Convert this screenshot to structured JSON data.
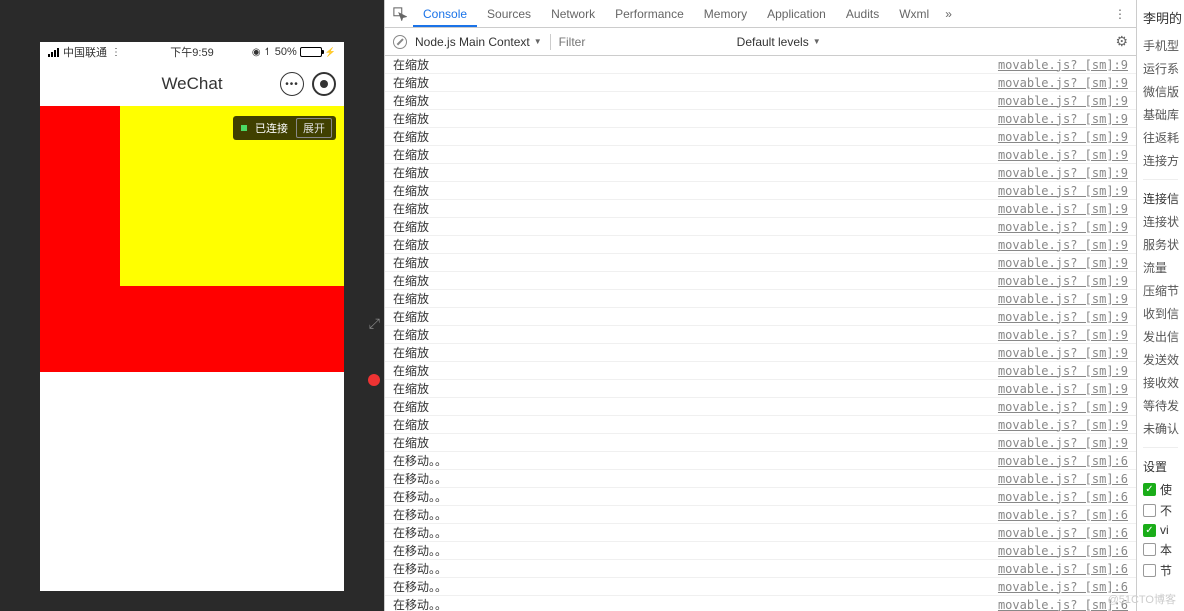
{
  "simulator": {
    "carrier": "中国联通",
    "time": "下午9:59",
    "battery_pct": "50%",
    "title": "WeChat",
    "conn_status": "已连接",
    "conn_btn": "展开"
  },
  "devtools": {
    "tabs": [
      "Console",
      "Sources",
      "Network",
      "Performance",
      "Memory",
      "Application",
      "Audits",
      "Wxml"
    ],
    "active_tab": "Console",
    "more": "»",
    "context": "Node.js Main Context",
    "filter_placeholder": "Filter",
    "levels": "Default levels",
    "logs_scale": [
      {
        "msg": "在缩放",
        "src": "movable.js? [sm]:9"
      },
      {
        "msg": "在缩放",
        "src": "movable.js? [sm]:9"
      },
      {
        "msg": "在缩放",
        "src": "movable.js? [sm]:9"
      },
      {
        "msg": "在缩放",
        "src": "movable.js? [sm]:9"
      },
      {
        "msg": "在缩放",
        "src": "movable.js? [sm]:9"
      },
      {
        "msg": "在缩放",
        "src": "movable.js? [sm]:9"
      },
      {
        "msg": "在缩放",
        "src": "movable.js? [sm]:9"
      },
      {
        "msg": "在缩放",
        "src": "movable.js? [sm]:9"
      },
      {
        "msg": "在缩放",
        "src": "movable.js? [sm]:9"
      },
      {
        "msg": "在缩放",
        "src": "movable.js? [sm]:9"
      },
      {
        "msg": "在缩放",
        "src": "movable.js? [sm]:9"
      },
      {
        "msg": "在缩放",
        "src": "movable.js? [sm]:9"
      },
      {
        "msg": "在缩放",
        "src": "movable.js? [sm]:9"
      },
      {
        "msg": "在缩放",
        "src": "movable.js? [sm]:9"
      },
      {
        "msg": "在缩放",
        "src": "movable.js? [sm]:9"
      },
      {
        "msg": "在缩放",
        "src": "movable.js? [sm]:9"
      },
      {
        "msg": "在缩放",
        "src": "movable.js? [sm]:9"
      },
      {
        "msg": "在缩放",
        "src": "movable.js? [sm]:9"
      },
      {
        "msg": "在缩放",
        "src": "movable.js? [sm]:9"
      },
      {
        "msg": "在缩放",
        "src": "movable.js? [sm]:9"
      },
      {
        "msg": "在缩放",
        "src": "movable.js? [sm]:9"
      },
      {
        "msg": "在缩放",
        "src": "movable.js? [sm]:9"
      }
    ],
    "logs_move": [
      {
        "msg": "在移动。。",
        "src": "movable.js? [sm]:6"
      },
      {
        "msg": "在移动。。",
        "src": "movable.js? [sm]:6"
      },
      {
        "msg": "在移动。。",
        "src": "movable.js? [sm]:6"
      },
      {
        "msg": "在移动。。",
        "src": "movable.js? [sm]:6"
      },
      {
        "msg": "在移动。。",
        "src": "movable.js? [sm]:6"
      },
      {
        "msg": "在移动。。",
        "src": "movable.js? [sm]:6"
      },
      {
        "msg": "在移动。。",
        "src": "movable.js? [sm]:6"
      },
      {
        "msg": "在移动。。",
        "src": "movable.js? [sm]:6"
      },
      {
        "msg": "在移动。。",
        "src": "movable.js? [sm]:6"
      }
    ]
  },
  "right_panel": {
    "owner": "李明的",
    "items1": [
      "手机型",
      "运行系",
      "微信版",
      "基础库",
      "往返耗",
      "连接方"
    ],
    "heading2": "连接信",
    "items2": [
      "连接状",
      "服务状",
      "流量",
      "压缩节",
      "收到信",
      "发出信",
      "发送效",
      "接收效",
      "等待发",
      "未确认"
    ],
    "heading3": "设置",
    "checks": [
      {
        "checked": true,
        "label": "使"
      },
      {
        "checked": false,
        "label": "不"
      },
      {
        "checked": true,
        "label": "vi"
      },
      {
        "checked": false,
        "label": "本"
      },
      {
        "checked": false,
        "label": "节",
        "box": true
      }
    ]
  },
  "watermark": "@51CTO博客"
}
